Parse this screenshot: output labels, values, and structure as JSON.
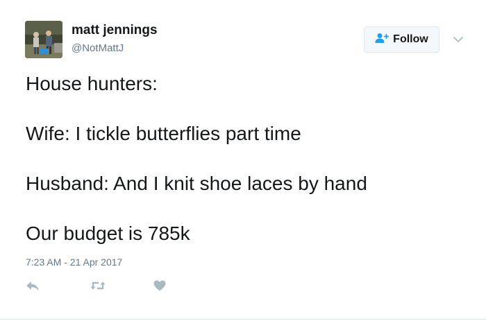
{
  "author": {
    "display_name": "matt jennings",
    "handle": "@NotMattJ"
  },
  "follow_button": {
    "label": "Follow",
    "icon": "add-user-icon"
  },
  "menu_icon": "chevron-down-icon",
  "tweet": {
    "lines": [
      "House hunters:",
      "Wife: I tickle butterflies part time",
      "Husband: And I knit shoe laces by hand",
      "Our budget is 785k"
    ],
    "timestamp": "7:23 AM - 21 Apr 2017"
  },
  "actions": [
    {
      "name": "reply",
      "icon": "reply-icon"
    },
    {
      "name": "retweet",
      "icon": "retweet-icon"
    },
    {
      "name": "like",
      "icon": "heart-icon"
    }
  ],
  "colors": {
    "text": "#14171a",
    "secondary_text": "#657786",
    "action_icon": "#aab8c2",
    "follow_icon": "#1da1f2",
    "border": "#e1e8ed"
  }
}
